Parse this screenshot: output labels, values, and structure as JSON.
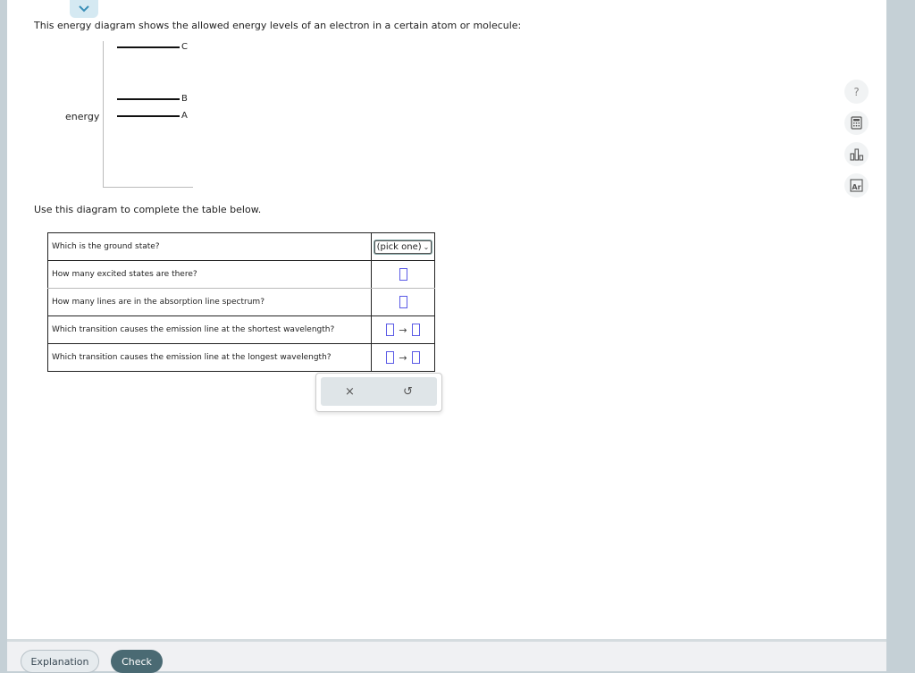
{
  "intro_text": "This energy diagram shows the allowed energy levels of an electron in a certain atom or molecule:",
  "diagram": {
    "axis_label": "energy",
    "levels": [
      {
        "label": "C"
      },
      {
        "label": "B"
      },
      {
        "label": "A"
      }
    ]
  },
  "instruction_text": "Use this diagram to complete the table below.",
  "table": {
    "rows": [
      {
        "question": "Which is the ground state?",
        "answer_type": "select",
        "select_value": "(pick one)"
      },
      {
        "question": "How many excited states are there?",
        "answer_type": "box"
      },
      {
        "question": "How many lines are in the absorption line spectrum?",
        "answer_type": "box"
      },
      {
        "question": "Which transition causes the emission line at the shortest wavelength?",
        "answer_type": "transition",
        "arrow": "→"
      },
      {
        "question": "Which transition causes the emission line at the longest wavelength?",
        "answer_type": "transition",
        "arrow": "→"
      }
    ]
  },
  "actions": {
    "clear": "×",
    "undo": "↺"
  },
  "tools": {
    "help": "?"
  },
  "footer": {
    "explanation_label": "Explanation",
    "check_label": "Check"
  }
}
